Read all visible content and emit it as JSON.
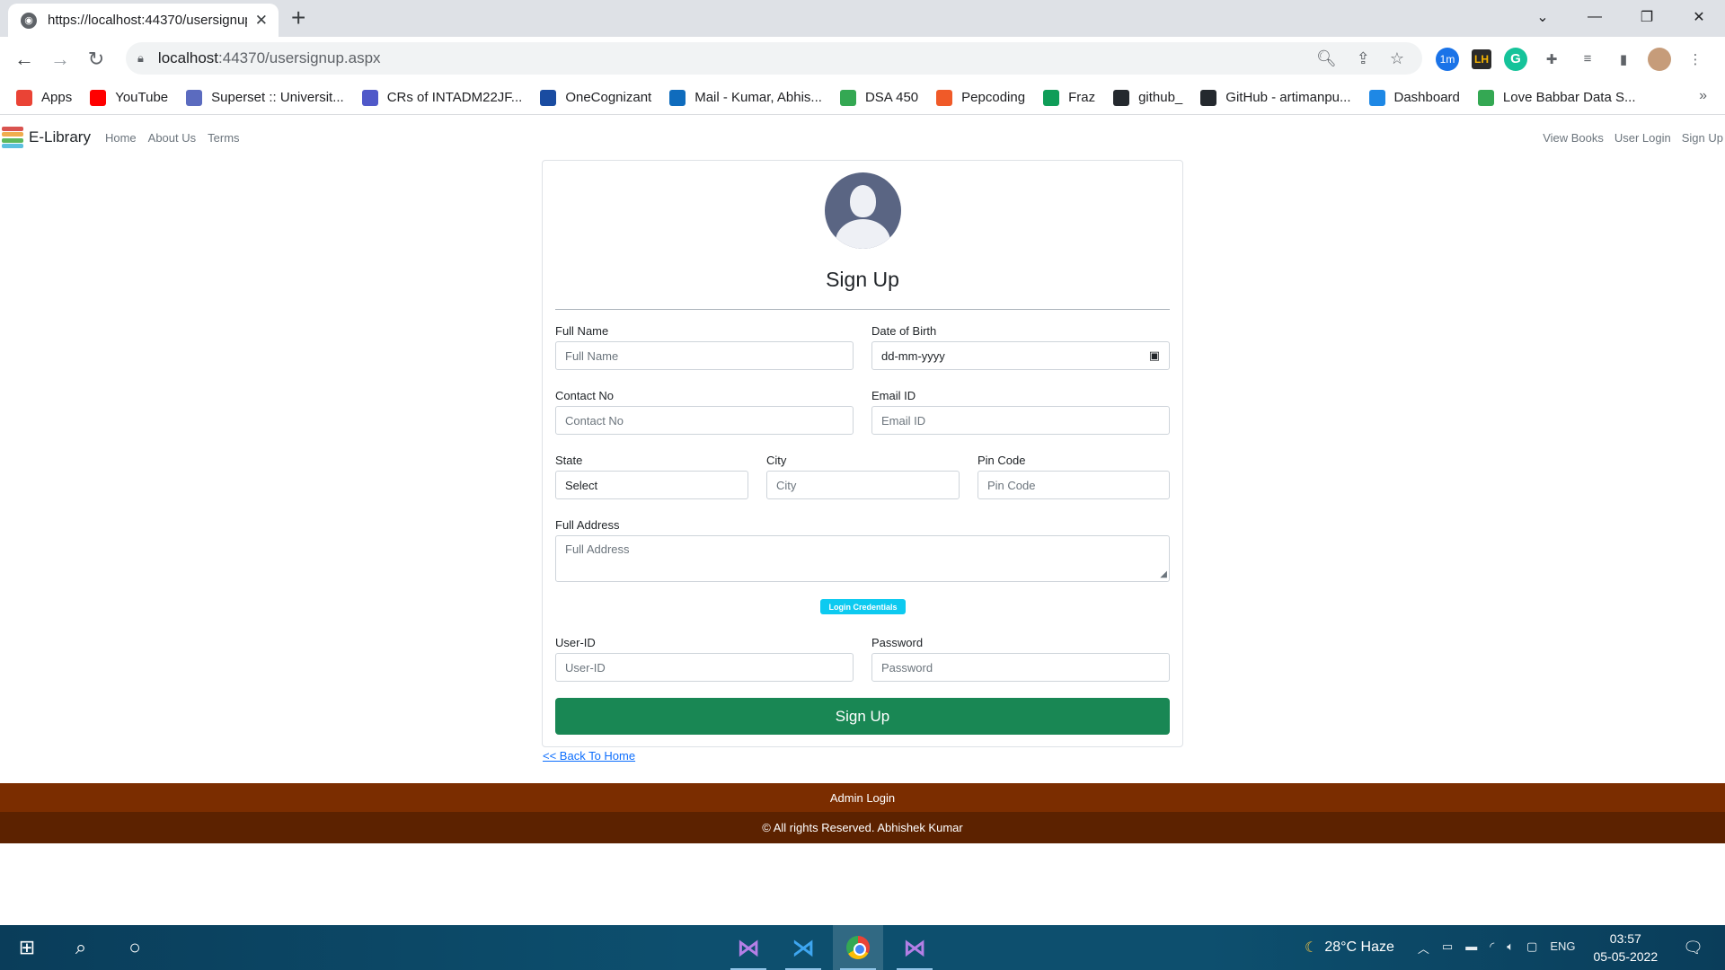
{
  "browser": {
    "tab_title": "https://localhost:44370/usersignup",
    "tab_close": "✕",
    "new_tab": "+",
    "window_controls": [
      "⌄",
      "—",
      "❐",
      "✕"
    ],
    "nav": {
      "back": "←",
      "forward": "→",
      "reload": "↻"
    },
    "url_host": "localhost",
    "url_path": ":44370/usersignup.aspx",
    "extension_badge": "1m",
    "bookmarks": [
      {
        "label": "Apps",
        "icon": "apps-grid-icon",
        "color": "#ea4335"
      },
      {
        "label": "YouTube",
        "icon": "youtube-icon",
        "color": "#ff0000"
      },
      {
        "label": "Superset :: Universit...",
        "icon": "superset-icon",
        "color": "#5b6bbf"
      },
      {
        "label": "CRs of INTADM22JF...",
        "icon": "teams-icon",
        "color": "#5059c9"
      },
      {
        "label": "OneCognizant",
        "icon": "cognizant-icon",
        "color": "#1a4ca1"
      },
      {
        "label": "Mail - Kumar, Abhis...",
        "icon": "outlook-icon",
        "color": "#0f6cbd"
      },
      {
        "label": "DSA 450",
        "icon": "drive-icon",
        "color": "#34a853"
      },
      {
        "label": "Pepcoding",
        "icon": "pepcoding-icon",
        "color": "#f05a28"
      },
      {
        "label": "Fraz",
        "icon": "sheets-icon",
        "color": "#0f9d58"
      },
      {
        "label": "github_",
        "icon": "github-icon",
        "color": "#24292e"
      },
      {
        "label": "GitHub - artimanpu...",
        "icon": "github-icon",
        "color": "#24292e"
      },
      {
        "label": "Dashboard",
        "icon": "dashboard-icon",
        "color": "#1e88e5"
      },
      {
        "label": "Love Babbar Data S...",
        "icon": "drive-icon",
        "color": "#34a853"
      }
    ],
    "bookmarks_more": "»"
  },
  "site": {
    "brand": "E-Library",
    "nav_left": [
      "Home",
      "About Us",
      "Terms"
    ],
    "nav_right": [
      "View Books",
      "User Login",
      "Sign Up"
    ]
  },
  "form": {
    "title": "Sign Up",
    "full_name": {
      "label": "Full Name",
      "placeholder": "Full Name"
    },
    "dob": {
      "label": "Date of Birth",
      "value": "dd-mm-yyyy"
    },
    "contact": {
      "label": "Contact No",
      "placeholder": "Contact No"
    },
    "email": {
      "label": "Email ID",
      "placeholder": "Email ID"
    },
    "state": {
      "label": "State",
      "value": "Select"
    },
    "city": {
      "label": "City",
      "placeholder": "City"
    },
    "pin": {
      "label": "Pin Code",
      "placeholder": "Pin Code"
    },
    "address": {
      "label": "Full Address",
      "placeholder": "Full Address"
    },
    "credentials_badge": "Login Credentials",
    "user_id": {
      "label": "User-ID",
      "placeholder": "User-ID"
    },
    "password": {
      "label": "Password",
      "placeholder": "Password"
    },
    "submit": "Sign Up",
    "back_link": "<< Back To Home"
  },
  "footer": {
    "admin_login": "Admin Login",
    "copyright": "© All rights Reserved. Abhishek Kumar"
  },
  "taskbar": {
    "weather": "28°C  Haze",
    "language": "ENG",
    "time": "03:57",
    "date": "05-05-2022"
  },
  "colors": {
    "signup_green": "#198754",
    "footer_top": "#7b2d00",
    "footer_bottom": "#5c2200",
    "badge_cyan": "#0dcaf0",
    "link_blue": "#0d6efd"
  }
}
